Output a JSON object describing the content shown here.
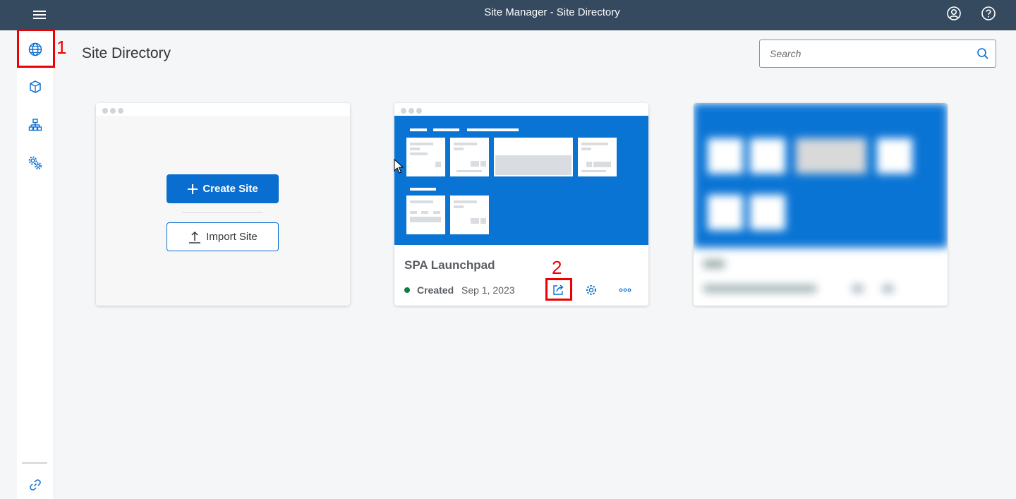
{
  "header": {
    "title": "Site Manager - Site Directory",
    "background": "#354a5f"
  },
  "sidebar": {
    "items": [
      {
        "icon": "globe-icon",
        "name": "Site Directory",
        "active": true
      },
      {
        "icon": "cube-icon",
        "name": "Content Manager"
      },
      {
        "icon": "hierarchy-icon",
        "name": "Channel Manager"
      },
      {
        "icon": "gears-icon",
        "name": "Settings"
      }
    ],
    "footer_icon": "link-icon"
  },
  "annotations": {
    "marker_1": "1",
    "marker_2": "2",
    "color": "#e00000"
  },
  "main": {
    "page_title": "Site Directory",
    "search": {
      "placeholder": "Search",
      "value": ""
    }
  },
  "create_card": {
    "create_label": "Create Site",
    "import_label": "Import Site"
  },
  "site_card": {
    "name": "SPA Launchpad",
    "status": "Created",
    "status_color": "#107e3e",
    "date": "Sep 1, 2023",
    "actions": [
      "share-icon",
      "settings-icon",
      "more-icon"
    ]
  },
  "accent_color": "#0a6ed1"
}
